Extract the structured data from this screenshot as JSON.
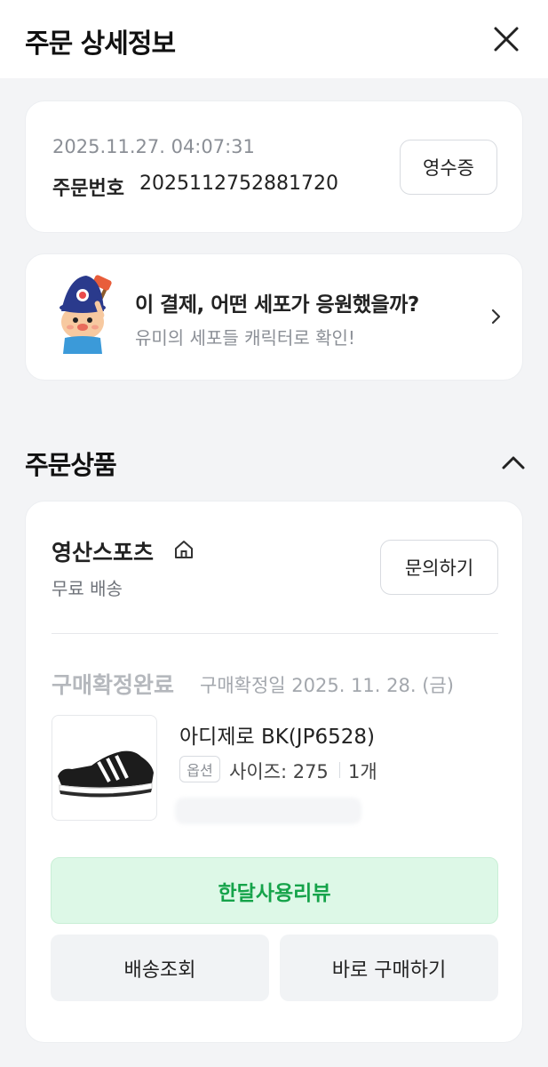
{
  "header": {
    "title": "주문 상세정보",
    "close_icon": "close-icon"
  },
  "order": {
    "datetime": "2025.11.27. 04:07:31",
    "number_label": "주문번호",
    "number_value": "2025112752881720",
    "receipt_label": "영수증"
  },
  "promo": {
    "title": "이 결제, 어떤 세포가 응원했을까?",
    "subtitle": "유미의 세포들 캐릭터로 확인!",
    "icon": "mascot-icon",
    "chevron": "chevron-right-icon"
  },
  "products_section": {
    "title": "주문상품",
    "toggle_icon": "chevron-up-icon"
  },
  "seller": {
    "name": "영산스포츠",
    "home_icon": "home-icon",
    "shipping": "무료 배송",
    "inquiry_label": "문의하기"
  },
  "item": {
    "status": "구매확정완료",
    "confirm_date": "구매확정일 2025. 11. 28. (금)",
    "name": "아디제로 BK(JP6528)",
    "option_tag": "옵션",
    "option_size": "사이즈: 275",
    "quantity": "1개"
  },
  "actions": {
    "review": "한달사용리뷰",
    "track": "배송조회",
    "buy_again": "바로 구매하기"
  },
  "colors": {
    "background": "#f3f4f6",
    "accent_green": "#15a34a",
    "review_bg": "#ddf8e7"
  }
}
